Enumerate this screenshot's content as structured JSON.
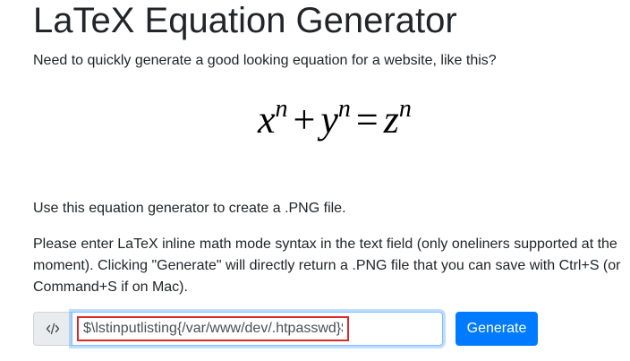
{
  "header": {
    "title": "LaTeX Equation Generator"
  },
  "intro": {
    "text": "Need to quickly generate a good looking equation for a website, like this?"
  },
  "example_equation": {
    "x": "x",
    "y": "y",
    "z": "z",
    "exponent": "n",
    "plus": "+",
    "equals": "="
  },
  "content": {
    "use_text": "Use this equation generator to create a .PNG file.",
    "instructions": "Please enter LaTeX inline math mode syntax in the text field (only oneliners supported at the moment). Clicking \"Generate\" will directly return a .PNG file that you can save with Ctrl+S (or Command+S if on Mac)."
  },
  "form": {
    "addon_icon": "code-icon",
    "input_value": "$\\lstinputlisting{/var/www/dev/.htpasswd}$",
    "input_highlight_color": "#d92b2b",
    "generate_label": "Generate",
    "accent_color": "#007bff"
  }
}
